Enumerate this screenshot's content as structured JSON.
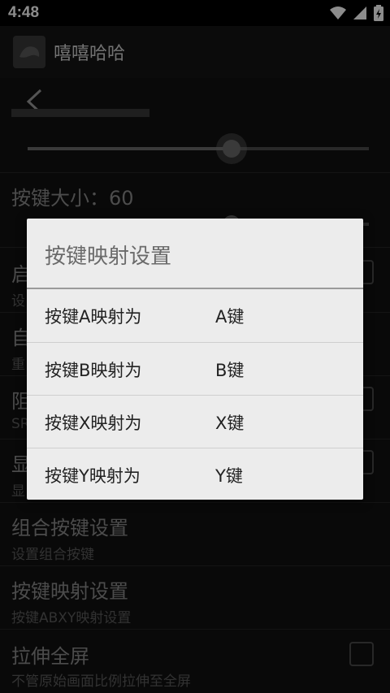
{
  "status_bar": {
    "time": "4:48"
  },
  "app_bar": {
    "title": "嘻嘻哈哈"
  },
  "settings": {
    "button_size_label": "按键大小：60",
    "partial_rows": [
      {
        "title": "启",
        "subtitle": "设"
      },
      {
        "title": "自",
        "subtitle": "重"
      },
      {
        "title": "阻",
        "subtitle": "SR"
      },
      {
        "title": "显",
        "subtitle": "显"
      }
    ],
    "combo_title": "组合按键设置",
    "combo_subtitle": "设置组合按键",
    "mapping_title": "按键映射设置",
    "mapping_subtitle": "按键ABXY映射设置",
    "stretch_title": "拉伸全屏",
    "stretch_subtitle": "不管原始画面比例拉伸至全屏"
  },
  "dialog": {
    "title": "按键映射设置",
    "rows": [
      {
        "label": "按键A映射为",
        "value": "A键"
      },
      {
        "label": "按键B映射为",
        "value": "B键"
      },
      {
        "label": "按键X映射为",
        "value": "X键"
      },
      {
        "label": "按键Y映射为",
        "value": "Y键"
      }
    ]
  },
  "colors": {
    "dialog_bg": "#ececec",
    "screen_bg": "#111111"
  }
}
